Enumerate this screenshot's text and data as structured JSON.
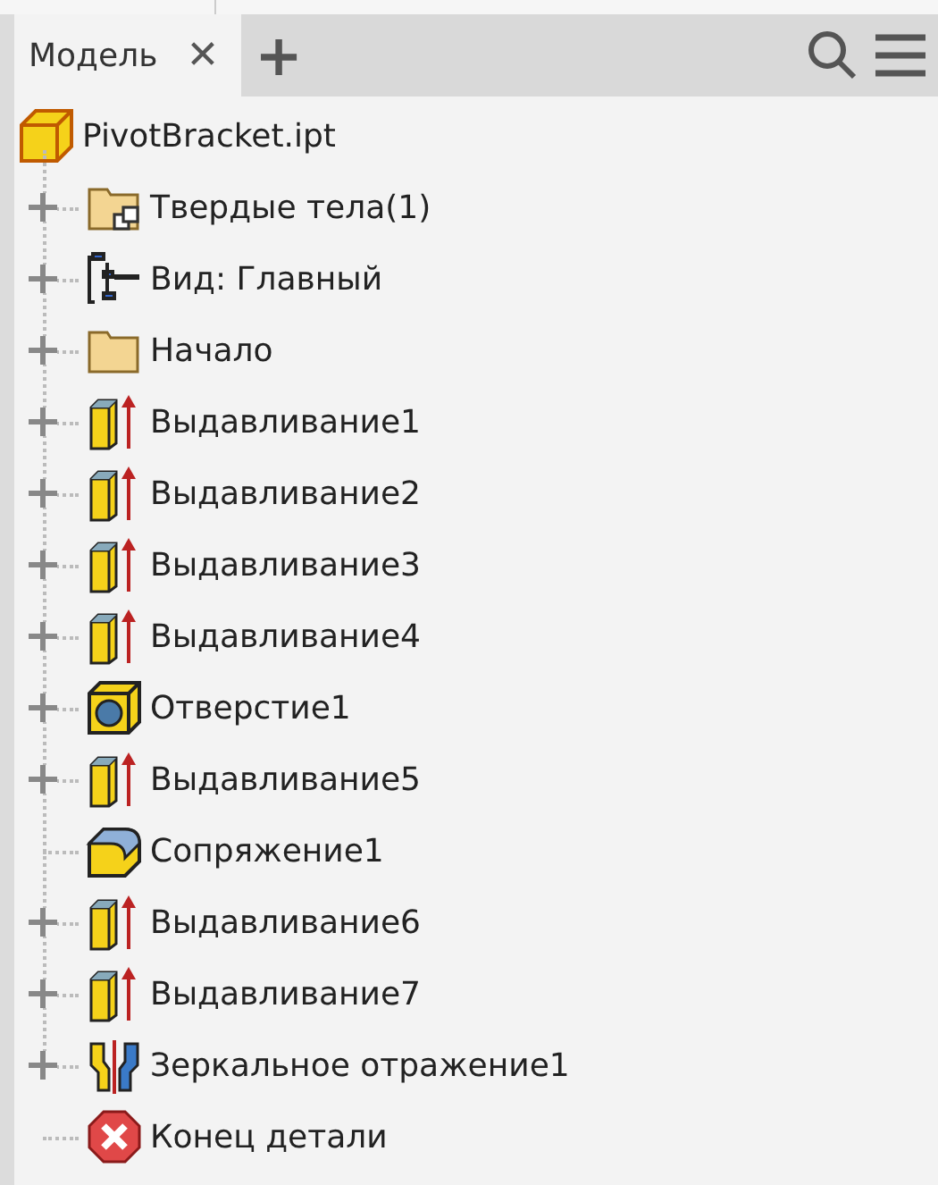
{
  "tabs": [
    {
      "label": "Модель",
      "selected": true,
      "close": "✕"
    }
  ],
  "add_tab": "+",
  "tree": {
    "label": "PivotBracket.ipt",
    "kind": "part",
    "children": [
      {
        "label": "Твердые тела(1)",
        "kind": "bodies",
        "expandable": true
      },
      {
        "label": "Вид: Главный",
        "kind": "view",
        "expandable": true
      },
      {
        "label": "Начало",
        "kind": "folder",
        "expandable": true
      },
      {
        "label": "Выдавливание1",
        "kind": "extrude",
        "expandable": true
      },
      {
        "label": "Выдавливание2",
        "kind": "extrude",
        "expandable": true
      },
      {
        "label": "Выдавливание3",
        "kind": "extrude",
        "expandable": true
      },
      {
        "label": "Выдавливание4",
        "kind": "extrude",
        "expandable": true
      },
      {
        "label": "Отверстие1",
        "kind": "hole",
        "expandable": true
      },
      {
        "label": "Выдавливание5",
        "kind": "extrude",
        "expandable": true
      },
      {
        "label": "Сопряжение1",
        "kind": "fillet",
        "expandable": false
      },
      {
        "label": "Выдавливание6",
        "kind": "extrude",
        "expandable": true
      },
      {
        "label": "Выдавливание7",
        "kind": "extrude",
        "expandable": true
      },
      {
        "label": "Зеркальное отражение1",
        "kind": "mirror",
        "expandable": true
      },
      {
        "label": "Конец детали",
        "kind": "end",
        "expandable": false
      }
    ]
  }
}
